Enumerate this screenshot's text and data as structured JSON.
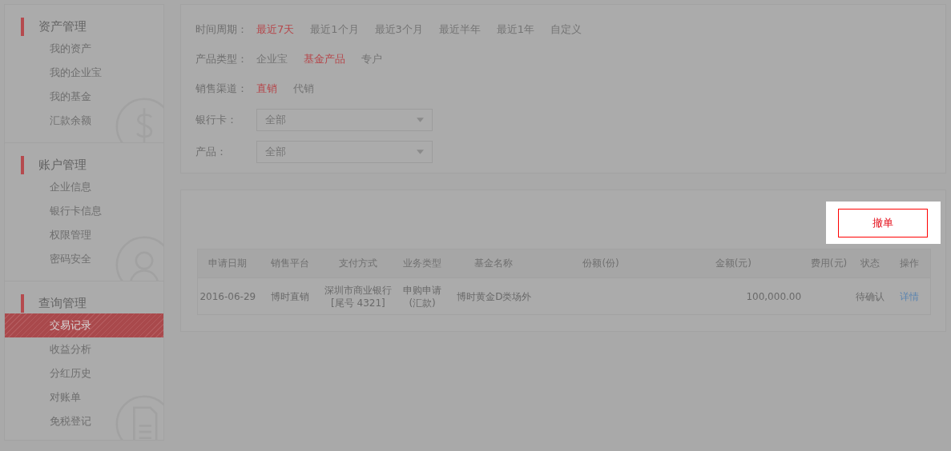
{
  "sidebar": {
    "groups": [
      {
        "title": "资产管理",
        "items": [
          {
            "label": "我的资产",
            "selected": false
          },
          {
            "label": "我的企业宝",
            "selected": false
          },
          {
            "label": "我的基金",
            "selected": false
          },
          {
            "label": "汇款余额",
            "selected": false
          }
        ]
      },
      {
        "title": "账户管理",
        "items": [
          {
            "label": "企业信息",
            "selected": false
          },
          {
            "label": "银行卡信息",
            "selected": false
          },
          {
            "label": "权限管理",
            "selected": false
          },
          {
            "label": "密码安全",
            "selected": false
          }
        ]
      },
      {
        "title": "查询管理",
        "items": [
          {
            "label": "交易记录",
            "selected": true
          },
          {
            "label": "收益分析",
            "selected": false
          },
          {
            "label": "分红历史",
            "selected": false
          },
          {
            "label": "对账单",
            "selected": false
          },
          {
            "label": "免税登记",
            "selected": false
          }
        ]
      }
    ]
  },
  "filters": [
    {
      "kind": "options",
      "label": "时间周期：",
      "options": [
        {
          "label": "最近7天",
          "selected": true
        },
        {
          "label": "最近1个月",
          "selected": false
        },
        {
          "label": "最近3个月",
          "selected": false
        },
        {
          "label": "最近半年",
          "selected": false
        },
        {
          "label": "最近1年",
          "selected": false
        },
        {
          "label": "自定义",
          "selected": false
        }
      ]
    },
    {
      "kind": "options",
      "label": "产品类型：",
      "options": [
        {
          "label": "企业宝",
          "selected": false
        },
        {
          "label": "基金产品",
          "selected": true
        },
        {
          "label": "专户",
          "selected": false
        }
      ]
    },
    {
      "kind": "options",
      "label": "销售渠道：",
      "options": [
        {
          "label": "直销",
          "selected": true
        },
        {
          "label": "代销",
          "selected": false
        }
      ]
    },
    {
      "kind": "select",
      "label": "银行卡：",
      "value": "全部"
    },
    {
      "kind": "select",
      "label": "产品：",
      "value": "全部"
    }
  ],
  "action_button": {
    "label": "撤单",
    "highlighted": true
  },
  "table": {
    "columns": [
      "申请日期",
      "销售平台",
      "支付方式",
      "业务类型",
      "基金名称",
      "份额(份)",
      "金额(元)",
      "费用(元)",
      "状态",
      "操作"
    ],
    "rows": [
      {
        "cells": [
          "2016-06-29",
          "博时直销",
          "深圳市商业银行\n[尾号 4321]",
          "申购申请\n(汇款)",
          "博时黄金D类场外",
          "",
          "100,000.00",
          "",
          "待确认",
          "详情"
        ]
      }
    ]
  }
}
